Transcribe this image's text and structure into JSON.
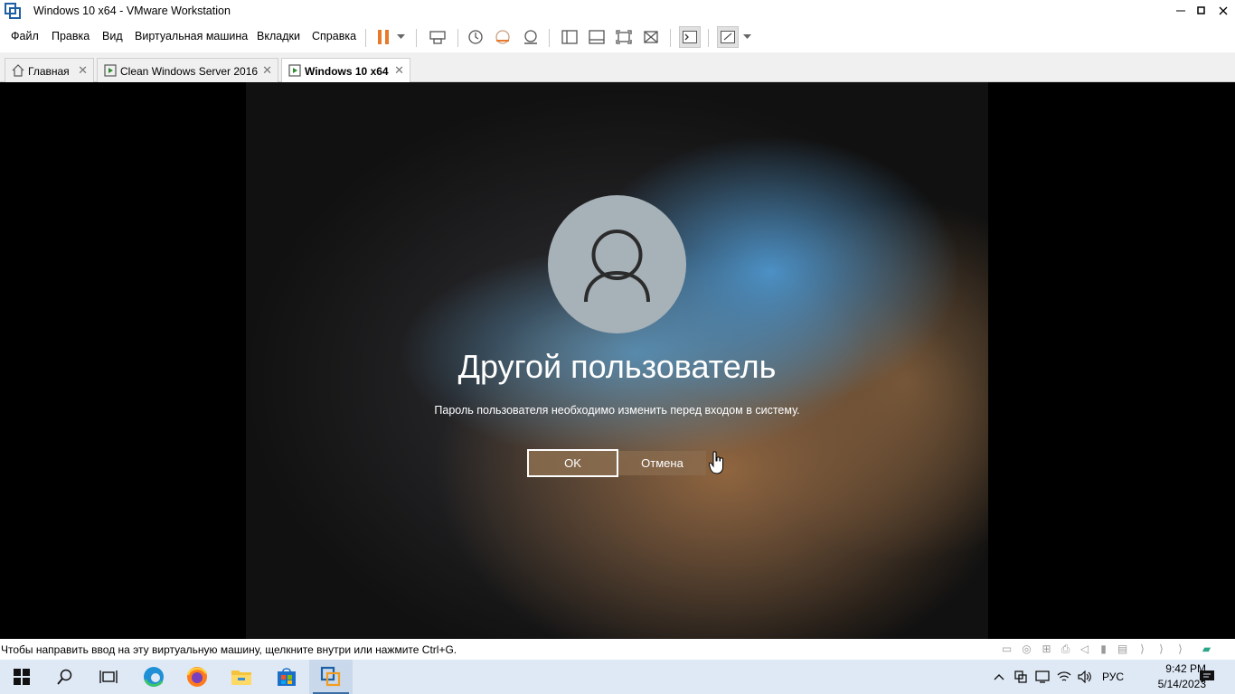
{
  "window": {
    "title": "Windows 10 x64 - VMware Workstation"
  },
  "menu": [
    "Файл",
    "Правка",
    "Вид",
    "Виртуальная машина",
    "Вкладки",
    "Справка"
  ],
  "tabs": [
    {
      "label": "Главная"
    },
    {
      "label": "Clean Windows Server 2016"
    },
    {
      "label": "Windows 10 x64"
    }
  ],
  "vm": {
    "title": "Другой пользователь",
    "message": "Пароль пользователя необходимо изменить перед входом в систему.",
    "ok_label": "OK",
    "cancel_label": "Отмена"
  },
  "status": {
    "text": "Чтобы направить ввод на эту виртуальную машину, щелкните внутри или нажмите Ctrl+G."
  },
  "taskbar": {
    "language": "РУС",
    "time": "9:42 PM",
    "date": "5/14/2023"
  },
  "colors": {
    "pause_accent": "#e8792a",
    "taskbar_bg": "#dfe9f5",
    "vm_button_bg": "#8c6e50"
  }
}
